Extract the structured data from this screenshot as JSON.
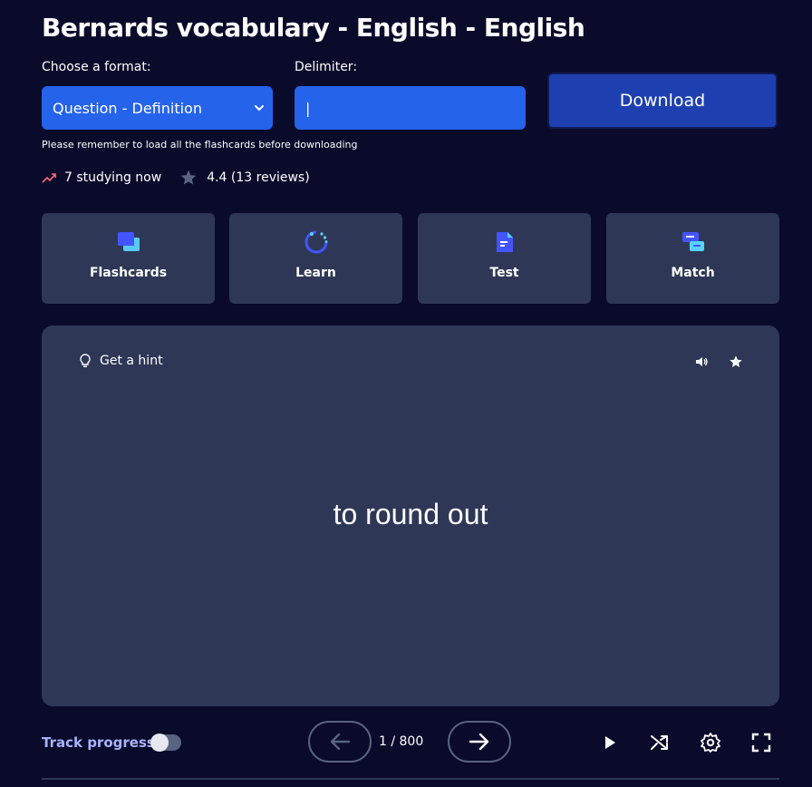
{
  "title": "Bernards vocabulary - English - English",
  "format_label": "Choose a format:",
  "format_value": "Question - Definition",
  "delimiter_label": "Delimiter:",
  "delimiter_value": "|",
  "download_label": "Download",
  "note": "Please remember to load all the flashcards before downloading",
  "stats": {
    "studying": "7 studying now",
    "rating": "4.4 (13 reviews)"
  },
  "modes": [
    {
      "label": "Flashcards",
      "icon": "flashcards-icon"
    },
    {
      "label": "Learn",
      "icon": "learn-icon"
    },
    {
      "label": "Test",
      "icon": "test-icon"
    },
    {
      "label": "Match",
      "icon": "match-icon"
    }
  ],
  "card": {
    "hint_label": "Get a hint",
    "term": "to round out"
  },
  "controls": {
    "track_progress_label": "Track progress",
    "track_progress_on": false,
    "counter": "1 / 800"
  },
  "colors": {
    "background": "#0a0a2a",
    "panel": "#2e3856",
    "accent": "#2563eb",
    "download": "#1e3fb0",
    "track_label": "#a8b3ff",
    "trend": "#ff6b7a",
    "star": "#586380"
  }
}
